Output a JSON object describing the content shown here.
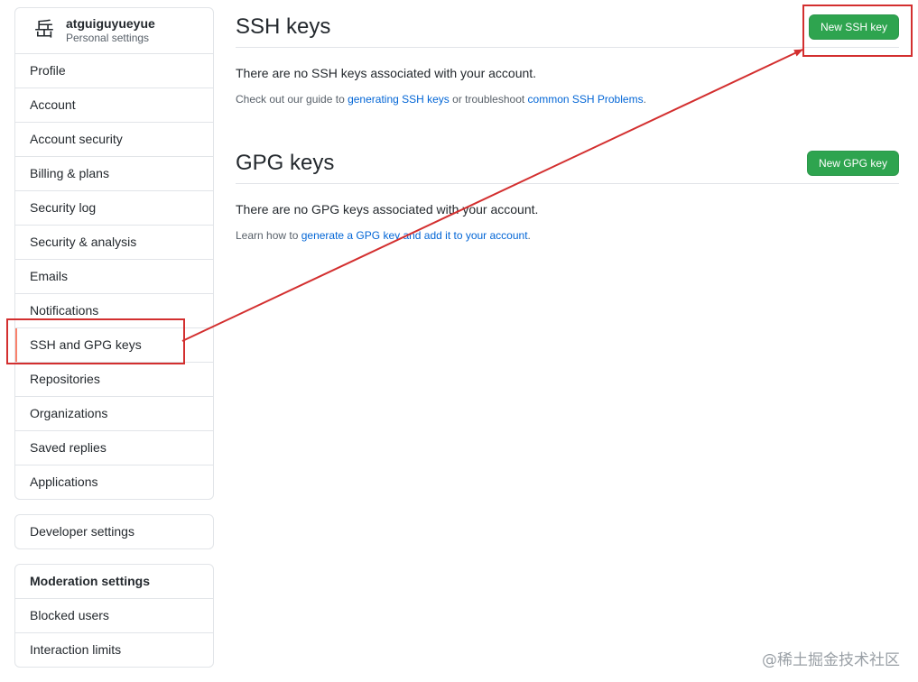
{
  "user": {
    "avatar_glyph": "岳",
    "username": "atguiguyueyue",
    "subtitle": "Personal settings"
  },
  "sidebar": {
    "items": [
      {
        "label": "Profile"
      },
      {
        "label": "Account"
      },
      {
        "label": "Account security"
      },
      {
        "label": "Billing & plans"
      },
      {
        "label": "Security log"
      },
      {
        "label": "Security & analysis"
      },
      {
        "label": "Emails"
      },
      {
        "label": "Notifications"
      },
      {
        "label": "SSH and GPG keys"
      },
      {
        "label": "Repositories"
      },
      {
        "label": "Organizations"
      },
      {
        "label": "Saved replies"
      },
      {
        "label": "Applications"
      }
    ],
    "developer_settings": "Developer settings",
    "moderation": {
      "heading": "Moderation settings",
      "items": [
        {
          "label": "Blocked users"
        },
        {
          "label": "Interaction limits"
        }
      ]
    }
  },
  "ssh": {
    "title": "SSH keys",
    "button": "New SSH key",
    "empty": "There are no SSH keys associated with your account.",
    "note_pre": "Check out our guide to ",
    "note_link1": "generating SSH keys",
    "note_mid": " or troubleshoot ",
    "note_link2": "common SSH Problems",
    "note_post": "."
  },
  "gpg": {
    "title": "GPG keys",
    "button": "New GPG key",
    "empty": "There are no GPG keys associated with your account.",
    "note_pre": "Learn how to ",
    "note_link": "generate a GPG key and add it to your account",
    "note_post": "."
  },
  "annotation": {
    "color": "#d32f2f"
  },
  "watermark": "@稀土掘金技术社区",
  "colors": {
    "accent_green": "#2ea44f",
    "link_blue": "#0366d6",
    "selected_marker": "#f9826c"
  }
}
